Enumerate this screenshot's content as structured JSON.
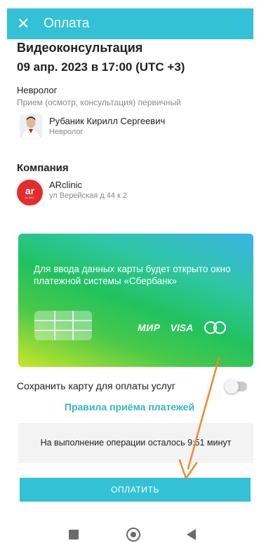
{
  "header": {
    "title": "Оплата",
    "close_icon": "close-icon"
  },
  "appointment": {
    "service": "Видеоконсультация",
    "datetime": "09 апр. 2023 в 17:00 (UTC +3)",
    "specialty": "Невролог",
    "type": "Прием (осмотр, консультация) первичный"
  },
  "doctor": {
    "name": "Рубаник Кирилл Сергеевич",
    "role": "Невролог"
  },
  "company": {
    "heading": "Компания",
    "logo_big": "ar",
    "logo_small": "CLINIC",
    "name": "ARclinic",
    "address": "ул Верейская д.44 к.2"
  },
  "card": {
    "info_text": "Для ввода данных карты будет открыто окно платежной системы «Сбербанк»",
    "brand_mir": "МИР",
    "brand_visa": "VISA",
    "brand_mastercard": "mastercard-icon"
  },
  "save_card": {
    "label": "Сохранить карту для оплаты услуг",
    "enabled": false
  },
  "rules_link": "Правила приёма платежей",
  "timer": {
    "text": "На выполнение операции осталось 9:51 минут"
  },
  "pay_button": "ОПЛАТИТЬ",
  "colors": {
    "accent": "#33c1d6",
    "link": "#33b6c8",
    "logo": "#e52b2b",
    "annotation_arrow": "#f0882f"
  },
  "system_nav": {
    "recents": "square-icon",
    "home": "circle-icon",
    "back": "triangle-back-icon"
  }
}
